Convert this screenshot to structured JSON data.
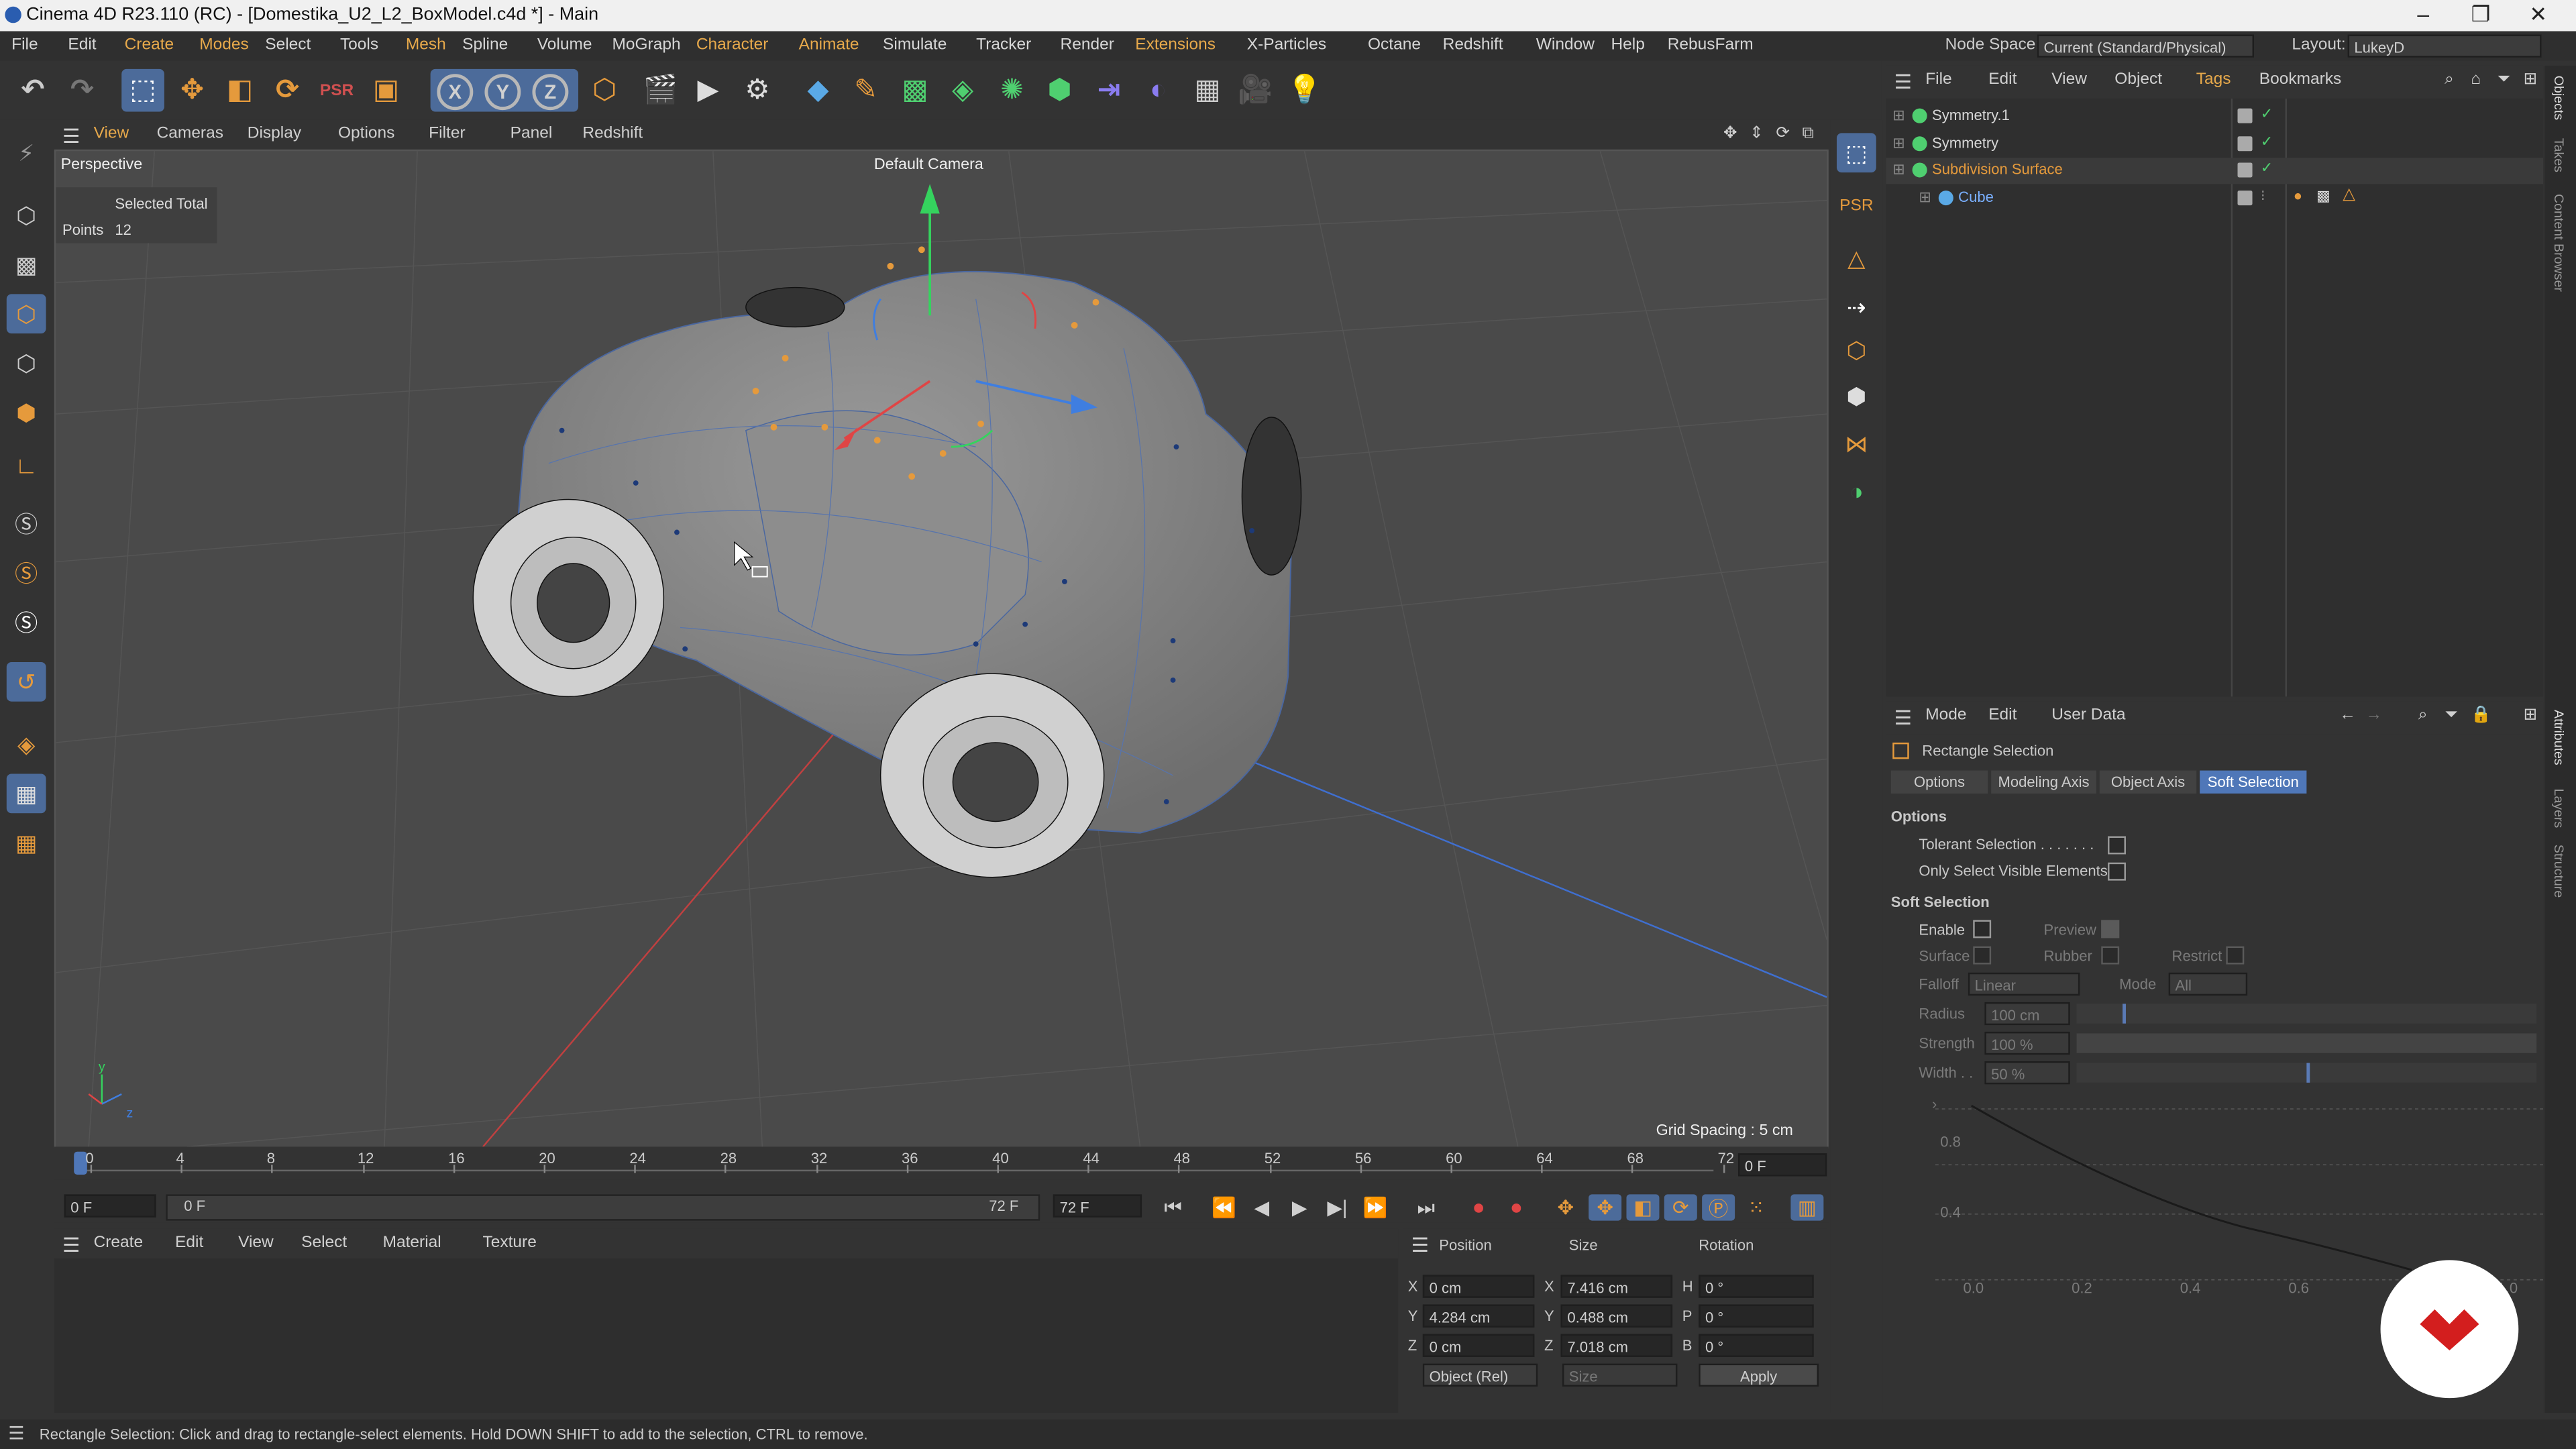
{
  "window": {
    "title": "Cinema 4D R23.110 (RC) - [Domestika_U2_L2_BoxModel.c4d *] - Main",
    "minimize": "–",
    "maximize": "❐",
    "close": "✕"
  },
  "menubar": {
    "items": [
      {
        "label": "File",
        "hl": false
      },
      {
        "label": "Edit",
        "hl": false
      },
      {
        "label": "Create",
        "hl": true
      },
      {
        "label": "Modes",
        "hl": true
      },
      {
        "label": "Select",
        "hl": false
      },
      {
        "label": "Tools",
        "hl": false
      },
      {
        "label": "Mesh",
        "hl": true
      },
      {
        "label": "Spline",
        "hl": false
      },
      {
        "label": "Volume",
        "hl": false
      },
      {
        "label": "MoGraph",
        "hl": false
      },
      {
        "label": "Character",
        "hl": true
      },
      {
        "label": "Animate",
        "hl": true
      },
      {
        "label": "Simulate",
        "hl": false
      },
      {
        "label": "Tracker",
        "hl": false
      },
      {
        "label": "Render",
        "hl": false
      },
      {
        "label": "Extensions",
        "hl": true
      },
      {
        "label": "X-Particles",
        "hl": false
      },
      {
        "label": "Octane",
        "hl": false
      },
      {
        "label": "Redshift",
        "hl": false
      },
      {
        "label": "Window",
        "hl": false
      },
      {
        "label": "Help",
        "hl": false
      },
      {
        "label": "RebusFarm",
        "hl": false
      }
    ],
    "node_space_label": "Node Space:",
    "node_space_value": "Current (Standard/Physical)",
    "layout_label": "Layout:",
    "layout_value": "LukeyD"
  },
  "viewport": {
    "menu": [
      "View",
      "Cameras",
      "Display",
      "Options",
      "Filter",
      "Panel",
      "Redshift"
    ],
    "projection": "Perspective",
    "camera": "Default Camera",
    "selection_header": "Selected Total",
    "points_label": "Points",
    "points_value": "12",
    "grid_spacing": "Grid Spacing : 5 cm"
  },
  "timeline": {
    "ticks": [
      "0",
      "4",
      "8",
      "12",
      "16",
      "20",
      "24",
      "28",
      "32",
      "36",
      "40",
      "44",
      "48",
      "52",
      "56",
      "60",
      "64",
      "68",
      "72"
    ],
    "current_frame": "0 F",
    "start": "0 F",
    "range_start": "0 F",
    "range_end": "72 F",
    "end": "72 F"
  },
  "material_manager": {
    "menu": [
      "Create",
      "Edit",
      "View",
      "Select",
      "Material",
      "Texture"
    ]
  },
  "coordinates": {
    "headers": [
      "Position",
      "Size",
      "Rotation"
    ],
    "rows": [
      {
        "axis": "X",
        "pos": "0 cm",
        "saxis": "X",
        "size": "7.416 cm",
        "raxis": "H",
        "rot": "0 °"
      },
      {
        "axis": "Y",
        "pos": "4.284 cm",
        "saxis": "Y",
        "size": "0.488 cm",
        "raxis": "P",
        "rot": "0 °"
      },
      {
        "axis": "Z",
        "pos": "0 cm",
        "saxis": "Z",
        "size": "7.018 cm",
        "raxis": "B",
        "rot": "0 °"
      }
    ],
    "mode": "Object (Rel)",
    "size_mode": "Size",
    "apply": "Apply"
  },
  "object_manager": {
    "menu": [
      "File",
      "Edit",
      "View",
      "Object",
      "Tags",
      "Bookmarks"
    ],
    "objects": [
      {
        "name": "Symmetry.1",
        "color": "#d8d8d8"
      },
      {
        "name": "Symmetry",
        "color": "#d8d8d8"
      },
      {
        "name": "Subdivision Surface",
        "color": "#e59a3c"
      },
      {
        "name": "Cube",
        "color": "#7ab0ff"
      }
    ]
  },
  "attribute_manager": {
    "menu": [
      "Mode",
      "Edit",
      "User Data"
    ],
    "tool": "Rectangle Selection",
    "tabs": [
      "Options",
      "Modeling Axis",
      "Object Axis",
      "Soft Selection"
    ],
    "options_header": "Options",
    "tolerant": "Tolerant Selection . . . . . . .",
    "visible_only": "Only Select Visible Elements",
    "soft_header": "Soft Selection",
    "enable": "Enable",
    "preview": "Preview",
    "surface": "Surface",
    "rubber": "Rubber",
    "restrict": "Restrict",
    "falloff_label": "Falloff",
    "falloff_value": "Linear",
    "mode_label": "Mode",
    "mode_value": "All",
    "radius_label": "Radius",
    "radius_value": "100 cm",
    "strength_label": "Strength",
    "strength_value": "100 %",
    "width_label": "Width . .",
    "width_value": "50 %",
    "graph_y": [
      "0.8",
      "0.4"
    ],
    "graph_x": [
      "0.0",
      "0.2",
      "0.4",
      "0.6",
      "1.0"
    ]
  },
  "side_tabs": [
    "Objects",
    "Takes",
    "Content Browser",
    "Attributes",
    "Layers",
    "Structure"
  ],
  "status": "Rectangle Selection: Click and drag to rectangle-select elements. Hold DOWN SHIFT to add to the selection, CTRL to remove.",
  "colors": {
    "accent": "#4f77b8",
    "highlight": "#e7a94b",
    "brand_logo": "#d31e1e"
  }
}
